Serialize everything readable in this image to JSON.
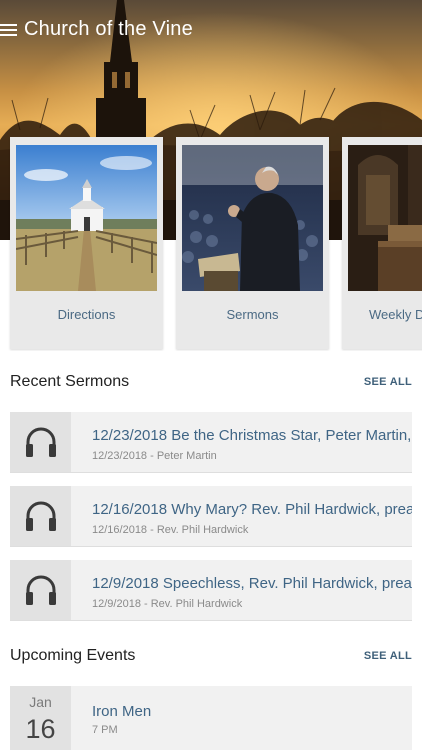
{
  "app": {
    "title": "Church of the Vine",
    "menu_icon": "hamburger-icon"
  },
  "cards": [
    {
      "label": "Directions",
      "image": "country-church-photo"
    },
    {
      "label": "Sermons",
      "image": "preacher-photo"
    },
    {
      "label": "Weekly De",
      "image": "church-interior-photo"
    }
  ],
  "sermons_section": {
    "title": "Recent Sermons",
    "see_all": "SEE ALL"
  },
  "sermons": [
    {
      "title": "12/23/2018 Be the Christmas Star, Peter Martin,",
      "subtitle": "12/23/2018 - Peter Martin",
      "icon": "headphones-icon"
    },
    {
      "title": "12/16/2018 Why Mary? Rev. Phil Hardwick, prea",
      "subtitle": "12/16/2018 - Rev. Phil Hardwick",
      "icon": "headphones-icon"
    },
    {
      "title": "12/9/2018 Speechless, Rev. Phil Hardwick, prea",
      "subtitle": "12/9/2018 - Rev. Phil Hardwick",
      "icon": "headphones-icon"
    }
  ],
  "events_section": {
    "title": "Upcoming Events",
    "see_all": "SEE ALL"
  },
  "events": [
    {
      "month": "Jan",
      "day": "16",
      "title": "Iron Men",
      "time": "7 PM"
    }
  ],
  "colors": {
    "accent_text": "#3f6585",
    "see_all": "#3f607a",
    "row_bg": "#f1f1f1",
    "icon_bg": "#e2e2e2"
  }
}
